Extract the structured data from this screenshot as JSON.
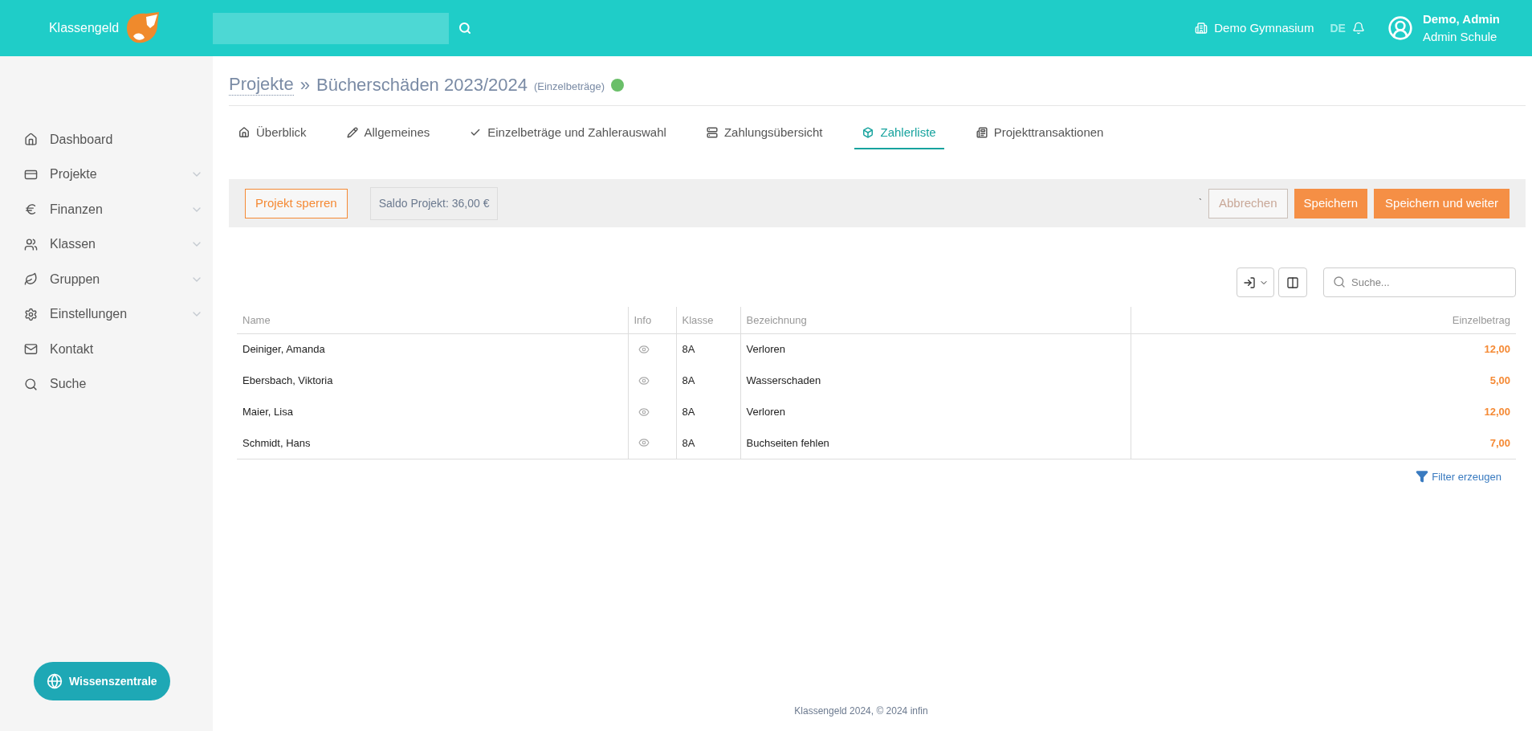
{
  "header": {
    "brand": "Klassengeld",
    "school": "Demo Gymnasium",
    "language": {
      "label": "DE",
      "selected": true
    },
    "user": {
      "name": "Demo, Admin",
      "role": "Admin Schule"
    }
  },
  "sidebar": {
    "items": [
      {
        "label": "Dashboard",
        "expandable": false
      },
      {
        "label": "Projekte",
        "expandable": true
      },
      {
        "label": "Finanzen",
        "expandable": true
      },
      {
        "label": "Klassen",
        "expandable": true
      },
      {
        "label": "Gruppen",
        "expandable": true
      },
      {
        "label": "Einstellungen",
        "expandable": true
      },
      {
        "label": "Kontakt",
        "expandable": false
      },
      {
        "label": "Suche",
        "expandable": false
      }
    ],
    "help_button": "Wissenszentrale"
  },
  "breadcrumb": {
    "parent": "Projekte",
    "separator": "»",
    "title": "Bücherschäden 2023/2024",
    "subtitle": "(Einzelbeträge)",
    "active": true
  },
  "tabs": [
    {
      "label": "Überblick",
      "selected": false
    },
    {
      "label": "Allgemeines",
      "selected": false
    },
    {
      "label": "Einzelbeträge und Zahlerauswahl",
      "selected": false
    },
    {
      "label": "Zahlungsübersicht",
      "selected": false
    },
    {
      "label": "Zahlerliste",
      "selected": true
    },
    {
      "label": "Projekttransaktionen",
      "selected": false
    }
  ],
  "action_bar": {
    "lock_button": "Projekt sperren",
    "balance": "Saldo Projekt: 36,00 €",
    "mark": "`",
    "cancel_button": {
      "label": "Abbrechen",
      "disabled": true
    },
    "save_button": "Speichern",
    "save_next_button": "Speichern und weiter"
  },
  "table_search": {
    "placeholder": "Suche..."
  },
  "table": {
    "columns": [
      "Name",
      "Info",
      "Klasse",
      "Bezeichnung",
      "Einzelbetrag"
    ],
    "rows": [
      {
        "name": "Deiniger, Amanda",
        "klasse": "8A",
        "bezeichnung": "Verloren",
        "einzelbetrag": "12,00"
      },
      {
        "name": "Ebersbach, Viktoria",
        "klasse": "8A",
        "bezeichnung": "Wasserschaden",
        "einzelbetrag": "5,00"
      },
      {
        "name": "Maier, Lisa",
        "klasse": "8A",
        "bezeichnung": "Verloren",
        "einzelbetrag": "12,00"
      },
      {
        "name": "Schmidt, Hans",
        "klasse": "8A",
        "bezeichnung": "Buchseiten fehlen",
        "einzelbetrag": "7,00"
      }
    ]
  },
  "filter_link": "Filter erzeugen",
  "footer": "Klassengeld 2024, © 2024 infin"
}
